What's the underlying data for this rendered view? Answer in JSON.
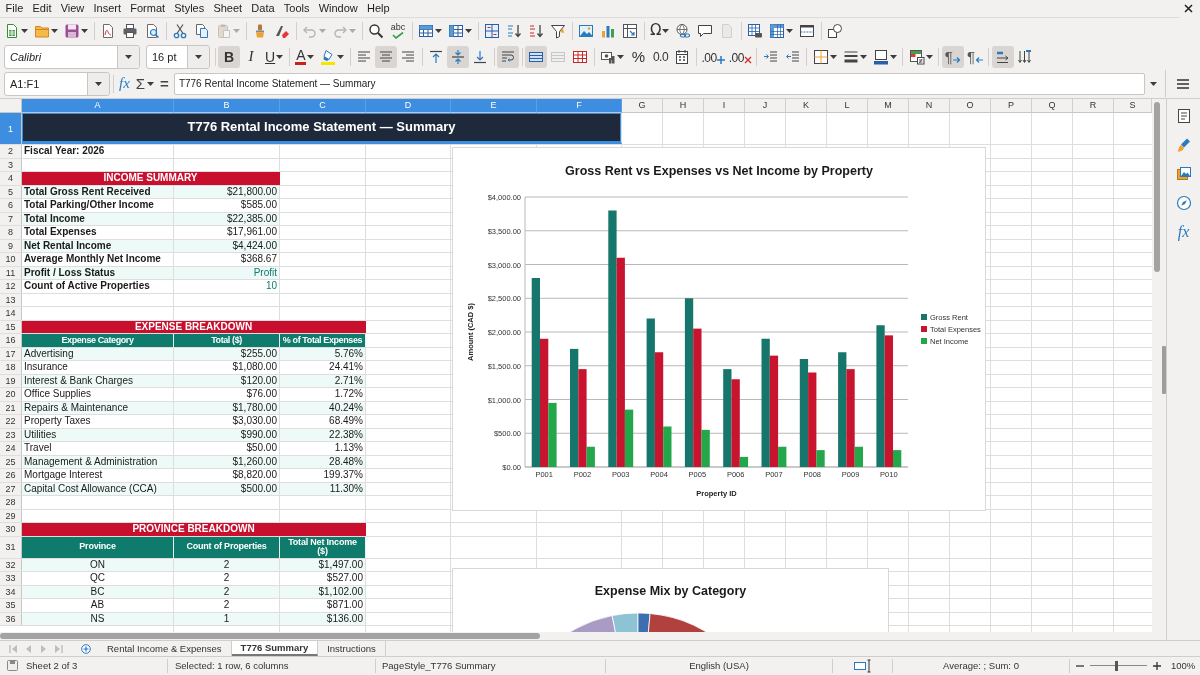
{
  "menu_bar": {
    "items": [
      "File",
      "Edit",
      "View",
      "Insert",
      "Format",
      "Styles",
      "Sheet",
      "Data",
      "Tools",
      "Window",
      "Help"
    ]
  },
  "standard_toolbar": {
    "groups": [
      [
        {
          "kind": "new",
          "disabled": false
        },
        {
          "kind": "open",
          "disabled": false
        },
        {
          "kind": "save",
          "disabled": false
        }
      ],
      [
        {
          "kind": "pdf",
          "disabled": false
        },
        {
          "kind": "print",
          "disabled": false
        },
        {
          "kind": "preview",
          "disabled": false
        }
      ],
      [
        {
          "kind": "cut",
          "disabled": false
        },
        {
          "kind": "copy",
          "disabled": false
        },
        {
          "kind": "paste",
          "disabled": true
        }
      ],
      [
        {
          "kind": "clone",
          "disabled": false
        },
        {
          "kind": "clear",
          "disabled": false
        }
      ],
      [
        {
          "kind": "undo",
          "disabled": true
        },
        {
          "kind": "redo",
          "disabled": true
        }
      ],
      [
        {
          "kind": "find",
          "disabled": false
        },
        {
          "kind": "spelling",
          "label": "abc",
          "disabled": false
        }
      ],
      [
        {
          "kind": "rows",
          "disabled": false
        },
        {
          "kind": "columns",
          "disabled": false
        }
      ],
      [
        {
          "kind": "sort",
          "disabled": false
        },
        {
          "kind": "ascending",
          "disabled": false
        },
        {
          "kind": "descending",
          "disabled": false
        },
        {
          "kind": "filter",
          "disabled": false
        }
      ],
      [
        {
          "kind": "image",
          "disabled": false
        },
        {
          "kind": "chart",
          "disabled": false
        },
        {
          "kind": "pivot",
          "disabled": false
        }
      ],
      [
        {
          "kind": "special",
          "label": "Ω",
          "disabled": false
        },
        {
          "kind": "hyperlink",
          "disabled": false
        },
        {
          "kind": "comment",
          "disabled": false
        },
        {
          "kind": "headers",
          "disabled": true
        }
      ],
      [
        {
          "kind": "printarea",
          "disabled": false
        },
        {
          "kind": "freeze",
          "disabled": false
        },
        {
          "kind": "split",
          "disabled": false
        }
      ],
      [
        {
          "kind": "draw",
          "disabled": false
        }
      ]
    ]
  },
  "formatting_toolbar": {
    "font_name": "Calibri",
    "font_size": "16 pt",
    "groups": [
      [
        {
          "kind": "bold",
          "label": "B",
          "on": true,
          "disabled": false
        },
        {
          "kind": "italic",
          "label": "I",
          "on": false,
          "disabled": false
        },
        {
          "kind": "underline",
          "label": "U",
          "on": false,
          "disabled": false
        }
      ],
      [
        {
          "kind": "fontcolor",
          "label": "A",
          "on": false,
          "disabled": false
        },
        {
          "kind": "highlight",
          "on": false,
          "disabled": false
        }
      ],
      [
        {
          "kind": "left",
          "on": false,
          "disabled": false
        },
        {
          "kind": "center",
          "on": true,
          "disabled": false
        },
        {
          "kind": "right",
          "on": false,
          "disabled": false
        }
      ],
      [
        {
          "kind": "top",
          "on": false,
          "disabled": false
        },
        {
          "kind": "middle",
          "on": true,
          "disabled": false
        },
        {
          "kind": "bottom",
          "on": false,
          "disabled": false
        }
      ],
      [
        {
          "kind": "wrap",
          "on": true,
          "disabled": false
        }
      ],
      [
        {
          "kind": "mergecenter",
          "on": true,
          "disabled": false
        },
        {
          "kind": "merge",
          "on": false,
          "disabled": true
        },
        {
          "kind": "unmerge",
          "on": false,
          "disabled": false
        }
      ],
      [
        {
          "kind": "currency",
          "on": false,
          "disabled": false
        },
        {
          "kind": "percent",
          "label": "%",
          "on": false,
          "disabled": false
        },
        {
          "kind": "number",
          "label": "0.0",
          "on": false,
          "disabled": false
        },
        {
          "kind": "date",
          "on": false,
          "disabled": false
        }
      ],
      [
        {
          "kind": "adddecimal",
          "label": ".00",
          "on": false,
          "disabled": false
        },
        {
          "kind": "deletedecimal",
          "label": ".00",
          "on": false,
          "disabled": false
        }
      ],
      [
        {
          "kind": "indent",
          "on": false,
          "disabled": false
        },
        {
          "kind": "outdent",
          "on": false,
          "disabled": false
        }
      ],
      [
        {
          "kind": "borders",
          "on": false,
          "disabled": false
        },
        {
          "kind": "borderstyle",
          "on": false,
          "disabled": false
        },
        {
          "kind": "bordercolor",
          "on": false,
          "disabled": false
        }
      ],
      [
        {
          "kind": "conditional",
          "on": false,
          "disabled": false
        }
      ],
      [
        {
          "kind": "ltr",
          "label": "¶",
          "on": true,
          "disabled": false
        },
        {
          "kind": "rtl",
          "label": "¶",
          "on": false,
          "disabled": false
        }
      ],
      [
        {
          "kind": "orientation",
          "on": true,
          "disabled": false
        },
        {
          "kind": "vertical",
          "on": false,
          "disabled": false
        }
      ]
    ]
  },
  "formula_bar": {
    "name_box": "A1:F1",
    "buttons": [
      {
        "kind": "wizard",
        "label": "fx"
      },
      {
        "kind": "sum",
        "label": "Σ"
      },
      {
        "kind": "formula",
        "label": "="
      }
    ],
    "content": "T776 Rental Income Statement — Summary"
  },
  "sheet": {
    "column_headers": [
      {
        "label": "A",
        "selected": true
      },
      {
        "label": "B",
        "selected": true
      },
      {
        "label": "C",
        "selected": true
      },
      {
        "label": "D",
        "selected": true
      },
      {
        "label": "E",
        "selected": true
      },
      {
        "label": "F",
        "selected": true
      },
      {
        "label": "G",
        "selected": false
      },
      {
        "label": "H",
        "selected": false
      },
      {
        "label": "I",
        "selected": false
      },
      {
        "label": "J",
        "selected": false
      },
      {
        "label": "K",
        "selected": false
      },
      {
        "label": "L",
        "selected": false
      },
      {
        "label": "M",
        "selected": false
      },
      {
        "label": "N",
        "selected": false
      },
      {
        "label": "O",
        "selected": false
      },
      {
        "label": "P",
        "selected": false
      },
      {
        "label": "Q",
        "selected": false
      },
      {
        "label": "R",
        "selected": false
      },
      {
        "label": "S",
        "selected": false
      }
    ],
    "row_headers": [
      {
        "label": "1",
        "selected": true
      },
      {
        "label": "2",
        "selected": false
      },
      {
        "label": "3",
        "selected": false
      },
      {
        "label": "4",
        "selected": false
      },
      {
        "label": "5",
        "selected": false
      },
      {
        "label": "6",
        "selected": false
      },
      {
        "label": "7",
        "selected": false
      },
      {
        "label": "8",
        "selected": false
      },
      {
        "label": "9",
        "selected": false
      },
      {
        "label": "10",
        "selected": false
      },
      {
        "label": "11",
        "selected": false
      },
      {
        "label": "12",
        "selected": false
      },
      {
        "label": "13",
        "selected": false
      },
      {
        "label": "14",
        "selected": false
      },
      {
        "label": "15",
        "selected": false
      },
      {
        "label": "16",
        "selected": false
      },
      {
        "label": "17",
        "selected": false
      },
      {
        "label": "18",
        "selected": false
      },
      {
        "label": "19",
        "selected": false
      },
      {
        "label": "20",
        "selected": false
      },
      {
        "label": "21",
        "selected": false
      },
      {
        "label": "22",
        "selected": false
      },
      {
        "label": "23",
        "selected": false
      },
      {
        "label": "24",
        "selected": false
      },
      {
        "label": "25",
        "selected": false
      },
      {
        "label": "26",
        "selected": false
      },
      {
        "label": "27",
        "selected": false
      },
      {
        "label": "28",
        "selected": false
      },
      {
        "label": "29",
        "selected": false
      },
      {
        "label": "30",
        "selected": false
      },
      {
        "label": "31",
        "selected": false
      },
      {
        "label": "32",
        "selected": false
      },
      {
        "label": "33",
        "selected": false
      },
      {
        "label": "34",
        "selected": false
      },
      {
        "label": "35",
        "selected": false
      },
      {
        "label": "36",
        "selected": false
      }
    ],
    "title": "T776 Rental Income Statement — Summary",
    "fiscal_year": "Fiscal Year: 2026",
    "income_summary": {
      "title": "INCOME SUMMARY",
      "rows": [
        {
          "label": "Total Gross Rent Received",
          "value": "$21,800.00",
          "accent": false
        },
        {
          "label": "Total Parking/Other Income",
          "value": "$585.00",
          "accent": false
        },
        {
          "label": "Total Income",
          "value": "$22,385.00",
          "accent": false
        },
        {
          "label": "Total Expenses",
          "value": "$17,961.00",
          "accent": false
        },
        {
          "label": "Net Rental Income",
          "value": "$4,424.00",
          "accent": false
        },
        {
          "label": "Average Monthly Net Income",
          "value": "$368.67",
          "accent": false
        },
        {
          "label": "Profit / Loss Status",
          "value": "Profit",
          "accent": true
        },
        {
          "label": "Count of Active Properties",
          "value": "10",
          "accent": true
        }
      ]
    },
    "expense_breakdown": {
      "title": "EXPENSE BREAKDOWN",
      "columns": [
        "Expense Category",
        "Total ($)",
        "% of Total Expenses"
      ],
      "rows": [
        [
          "Advertising",
          "$255.00",
          "5.76%"
        ],
        [
          "Insurance",
          "$1,080.00",
          "24.41%"
        ],
        [
          "Interest & Bank Charges",
          "$120.00",
          "2.71%"
        ],
        [
          "Office Supplies",
          "$76.00",
          "1.72%"
        ],
        [
          "Repairs & Maintenance",
          "$1,780.00",
          "40.24%"
        ],
        [
          "Property Taxes",
          "$3,030.00",
          "68.49%"
        ],
        [
          "Utilities",
          "$990.00",
          "22.38%"
        ],
        [
          "Travel",
          "$50.00",
          "1.13%"
        ],
        [
          "Management & Administration",
          "$1,260.00",
          "28.48%"
        ],
        [
          "Mortgage Interest",
          "$8,820.00",
          "199.37%"
        ],
        [
          "Capital Cost Allowance (CCA)",
          "$500.00",
          "11.30%"
        ]
      ]
    },
    "province_breakdown": {
      "title": "PROVINCE BREAKDOWN",
      "columns": [
        "Province",
        "Count of Properties",
        "Total Net Income ($)"
      ],
      "rows": [
        [
          "ON",
          "2",
          "$1,497.00"
        ],
        [
          "QC",
          "2",
          "$527.00"
        ],
        [
          "BC",
          "2",
          "$1,102.00"
        ],
        [
          "AB",
          "2",
          "$871.00"
        ],
        [
          "NS",
          "1",
          "$136.00"
        ]
      ]
    },
    "charts": [
      {
        "chart_data": {
          "type": "bar",
          "title": "Gross Rent vs Expenses vs Net Income by Property",
          "xlabel": "Property ID",
          "ylabel": "Amount (CAD $)",
          "categories": [
            "P001",
            "P002",
            "P003",
            "P004",
            "P005",
            "P006",
            "P007",
            "P008",
            "P009",
            "P010"
          ],
          "series": [
            {
              "name": "Gross Rent",
              "color": "#17766b",
              "values": [
                2800,
                1750,
                3800,
                2200,
                2500,
                1450,
                1900,
                1600,
                1700,
                2100
              ]
            },
            {
              "name": "Total Expenses",
              "color": "#c8142f",
              "values": [
                1900,
                1450,
                3100,
                1700,
                2050,
                1300,
                1650,
                1400,
                1450,
                1950
              ]
            },
            {
              "name": "Net Income",
              "color": "#22a84a",
              "values": [
                950,
                300,
                850,
                600,
                550,
                150,
                300,
                250,
                300,
                250
              ]
            }
          ],
          "ylim": [
            0,
            4000
          ],
          "yticks": [
            {
              "value": 0,
              "label": "$0.00"
            },
            {
              "value": 500,
              "label": "$500.00"
            },
            {
              "value": 1000,
              "label": "$1,000.00"
            },
            {
              "value": 1500,
              "label": "$1,500.00"
            },
            {
              "value": 2000,
              "label": "$2,000.00"
            },
            {
              "value": 2500,
              "label": "$2,500.00"
            },
            {
              "value": 3000,
              "label": "$3,000.00"
            },
            {
              "value": 3500,
              "label": "$3,500.00"
            },
            {
              "value": 4000,
              "label": "$4,000.00"
            }
          ],
          "grid": true,
          "legend": "right"
        }
      },
      {
        "title": "Expense Mix by Category"
      }
    ]
  },
  "sheet_tabs": {
    "navigation": [
      {
        "kind": "first",
        "disabled": true
      },
      {
        "kind": "previous",
        "disabled": true
      },
      {
        "kind": "next",
        "disabled": true
      },
      {
        "kind": "last",
        "disabled": true
      }
    ],
    "tabs": [
      {
        "label": "Rental Income & Expenses",
        "selected": false
      },
      {
        "label": "T776 Summary",
        "selected": true
      },
      {
        "label": "Instructions",
        "selected": false
      }
    ]
  },
  "status_bar": {
    "sheet": "Sheet 2 of 3",
    "selection": "Selected: 1 row, 6 columns",
    "page_style": "PageStyle_T776 Summary",
    "language": "English (USA)",
    "summary": "Average: ; Sum: 0",
    "zoom_slider": {
      "level": 0.46
    },
    "zoom": "100%"
  },
  "sidebar": {
    "buttons": [
      {
        "kind": "properties"
      },
      {
        "kind": "styles"
      },
      {
        "kind": "gallery"
      },
      {
        "kind": "navigator"
      },
      {
        "kind": "functions",
        "label": "fx"
      }
    ]
  }
}
